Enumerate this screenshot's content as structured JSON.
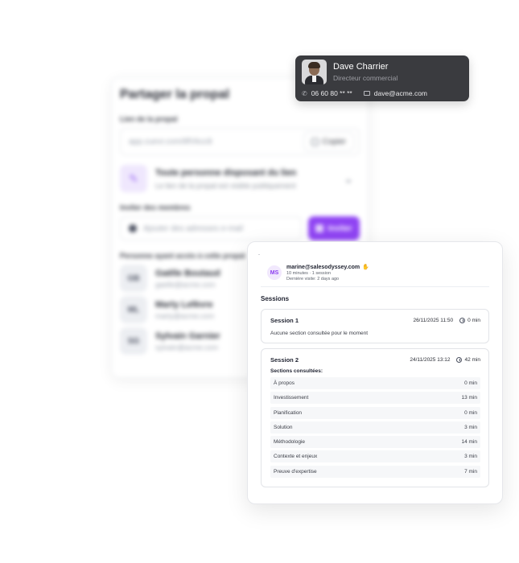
{
  "share_panel": {
    "title": "Partager la propal",
    "link_label": "Lien de la propal",
    "link_url": "app.cuevr.com/8fVkcc8",
    "copy_label": "Copier",
    "access_title": "Toute personne disposant du lien",
    "access_subtitle": "Le lien de la propal est visible publiquement",
    "invite_label": "Inviter des membres",
    "invite_placeholder": "Ajouter des adresses e-mail",
    "invite_button": "Inviter",
    "members_label": "Personne ayant accès à cette propal",
    "members": [
      {
        "initials": "GB",
        "name": "Gaëlle Boutaud",
        "email": "gaelle@acme.com"
      },
      {
        "initials": "ML",
        "name": "Marty Lefèvre",
        "email": "marty@acme.com"
      },
      {
        "initials": "SG",
        "name": "Sylvain Garnier",
        "email": "sylvain@acme.com"
      }
    ]
  },
  "contact": {
    "name": "Dave Charrier",
    "role": "Directeur commercial",
    "phone": "06 60 80 ** **",
    "email": "dave@acme.com"
  },
  "visitor": {
    "tick": "-",
    "initials": "MS",
    "email": "marine@salesodyssey.com",
    "hand": "✋",
    "meta": "10 minutes · 1 session",
    "last_visit": "Dernière visite: 2 days ago"
  },
  "sessions_title": "Sessions",
  "sessions": [
    {
      "name": "Session 1",
      "date": "26/11/2025 11:50",
      "duration": "0 min",
      "note": "Aucune section consultée pour le moment"
    },
    {
      "name": "Session 2",
      "date": "24/11/2025 13:12",
      "duration": "42 min",
      "consulted_label": "Sections consultées:",
      "sections": [
        {
          "name": "À propos",
          "time": "0 min"
        },
        {
          "name": "Investissement",
          "time": "13 min"
        },
        {
          "name": "Planification",
          "time": "0 min"
        },
        {
          "name": "Solution",
          "time": "3 min"
        },
        {
          "name": "Méthodologie",
          "time": "14 min"
        },
        {
          "name": "Contexte et enjeux",
          "time": "3 min"
        },
        {
          "name": "Preuve d'expertise",
          "time": "7 min"
        }
      ]
    }
  ],
  "colors": {
    "accent": "#8f43f3",
    "tooltip_bg": "#3a3b3f"
  }
}
